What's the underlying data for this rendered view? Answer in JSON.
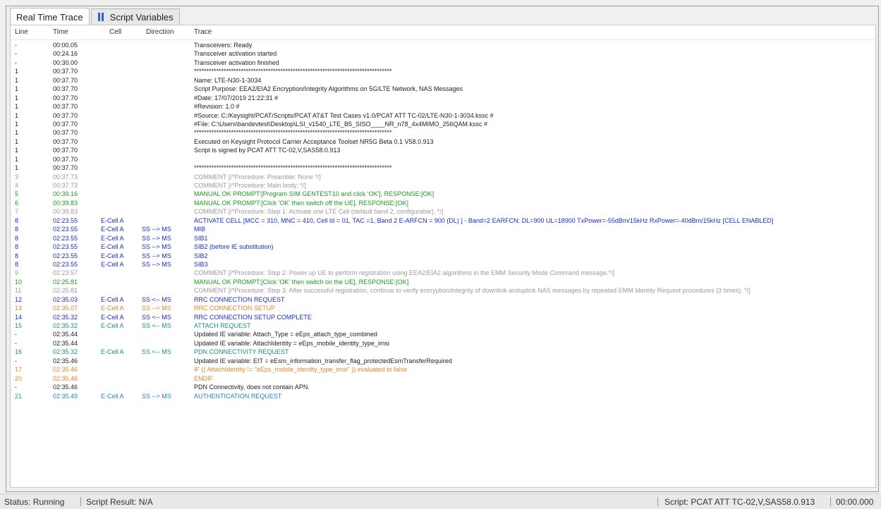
{
  "tabs": [
    {
      "label": "Real Time Trace"
    },
    {
      "label": "Script Variables"
    }
  ],
  "columns": {
    "line": "Line",
    "time": "Time",
    "cell": "Cell",
    "direction": "Direction",
    "trace": "Trace"
  },
  "rows": [
    {
      "line": "-",
      "time": "00:00.05",
      "cell": "",
      "dir": "",
      "trace": "Transceivers: Ready",
      "kind": "info"
    },
    {
      "line": "-",
      "time": "00:24.16",
      "cell": "",
      "dir": "",
      "trace": "Transceiver activation started",
      "kind": "info"
    },
    {
      "line": "-",
      "time": "00:30.00",
      "cell": "",
      "dir": "",
      "trace": "Transceiver activation finished",
      "kind": "info"
    },
    {
      "line": "1",
      "time": "00:37.70",
      "cell": "",
      "dir": "",
      "trace": "********************************************************************************",
      "kind": "info"
    },
    {
      "line": "1",
      "time": "00:37.70",
      "cell": "",
      "dir": "",
      "trace": "Name: LTE-N30-1-3034",
      "kind": "info"
    },
    {
      "line": "1",
      "time": "00:37.70",
      "cell": "",
      "dir": "",
      "trace": "Script Purpose: EEA2/EIA2 Encryption/Integrity Algorithms on 5G/LTE Network, NAS Messages",
      "kind": "info"
    },
    {
      "line": "1",
      "time": "00:37.70",
      "cell": "",
      "dir": "",
      "trace": "#Date: 17/07/2019 21:22:31 #",
      "kind": "info"
    },
    {
      "line": "1",
      "time": "00:37.70",
      "cell": "",
      "dir": "",
      "trace": "#Revision: 1.0 #",
      "kind": "info"
    },
    {
      "line": "1",
      "time": "00:37.70",
      "cell": "",
      "dir": "",
      "trace": "#Source: C:/Keysight/PCAT/Scripts/PCAT AT&T Test Cases v1.0/PCAT ATT TC-02/LTE-N30-1-3034.kssc #",
      "kind": "info"
    },
    {
      "line": "1",
      "time": "00:37.70",
      "cell": "",
      "dir": "",
      "trace": "#File: C:\\Users\\bandevtest\\Desktop\\LSI_v1540_LTE_B5_SISO____NR_n78_4x4MIMO_256QAM.kssc #",
      "kind": "info"
    },
    {
      "line": "1",
      "time": "00:37.70",
      "cell": "",
      "dir": "",
      "trace": "********************************************************************************",
      "kind": "info"
    },
    {
      "line": "1",
      "time": "00:37.70",
      "cell": "",
      "dir": "",
      "trace": "Executed on Keysight Protocol Carrier Acceptance Toolset NR5G Beta 0.1 V58.0.913",
      "kind": "info"
    },
    {
      "line": "1",
      "time": "00:37.70",
      "cell": "",
      "dir": "",
      "trace": "Script is signed by PCAT ATT TC-02,V,SAS58.0.913",
      "kind": "info"
    },
    {
      "line": "1",
      "time": "00:37.70",
      "cell": "",
      "dir": "",
      "trace": "",
      "kind": "info"
    },
    {
      "line": "1",
      "time": "00:37.70",
      "cell": "",
      "dir": "",
      "trace": "********************************************************************************",
      "kind": "info"
    },
    {
      "line": "3",
      "time": "00:37.73",
      "cell": "",
      "dir": "",
      "trace": "COMMENT [/*Procedure: Preamble: None */]",
      "kind": "comment"
    },
    {
      "line": "4",
      "time": "00:37.73",
      "cell": "",
      "dir": "",
      "trace": "COMMENT [/*Procedure: Main body: */]",
      "kind": "comment"
    },
    {
      "line": "5",
      "time": "00:39.16",
      "cell": "",
      "dir": "",
      "trace": "MANUAL OK PROMPT:[Program SIM GENTEST10 and click 'OK'], RESPONSE:[OK]",
      "kind": "manual"
    },
    {
      "line": "6",
      "time": "00:39.83",
      "cell": "",
      "dir": "",
      "trace": "MANUAL OK PROMPT:[Click 'OK' then switch off the UE], RESPONSE:[OK]",
      "kind": "manual"
    },
    {
      "line": "7",
      "time": "00:39.83",
      "cell": "",
      "dir": "",
      "trace": "COMMENT [/*Procedure: Step 1: Activate one LTE Cell (default band 2, configurable). */]",
      "kind": "comment"
    },
    {
      "line": "8",
      "time": "02:23.55",
      "cell": "E-Cell A",
      "dir": "",
      "trace": "ACTIVATE CELL [MCC = 310, MNC = 410, Cell Id = 01, TAC =1, Band 2 E-ARFCN = 900 (DL) ] - Band=2  EARFCN: DL=900 UL=18900  TxPower=-55dBm/15kHz  RxPower=-40dBm/15kHz  [CELL ENABLED]",
      "kind": "blue"
    },
    {
      "line": "8",
      "time": "02:23.55",
      "cell": "E-Cell A",
      "dir": "SS --> MS",
      "trace": "MIB",
      "kind": "blue"
    },
    {
      "line": "8",
      "time": "02:23.55",
      "cell": "E-Cell A",
      "dir": "SS --> MS",
      "trace": "SIB1",
      "kind": "blue"
    },
    {
      "line": "8",
      "time": "02:23.55",
      "cell": "E-Cell A",
      "dir": "SS --> MS",
      "trace": "SIB2 (before IE substitution)",
      "kind": "blue"
    },
    {
      "line": "8",
      "time": "02:23.55",
      "cell": "E-Cell A",
      "dir": "SS --> MS",
      "trace": "SIB2",
      "kind": "blue"
    },
    {
      "line": "8",
      "time": "02:23.55",
      "cell": "E-Cell A",
      "dir": "SS --> MS",
      "trace": "SIB3",
      "kind": "blue"
    },
    {
      "line": "9",
      "time": "02:23.57",
      "cell": "",
      "dir": "",
      "trace": "COMMENT [/*Procedure: Step 2: Power up UE to perform registration using EEA2/EIA2 algorithms in the EMM Security Mode Command message.*/]",
      "kind": "comment"
    },
    {
      "line": "10",
      "time": "02:25.81",
      "cell": "",
      "dir": "",
      "trace": "MANUAL OK PROMPT:[Click 'OK' then switch on the UE], RESPONSE:[OK]",
      "kind": "manual"
    },
    {
      "line": "11",
      "time": "02:25.81",
      "cell": "",
      "dir": "",
      "trace": "COMMENT [/*Procedure: Step 3: After successful registration, continue to verify encryption/integrity of downlink anduplink NAS messages by repeated EMM Identity Request procedures (3 times). */]",
      "kind": "comment"
    },
    {
      "line": "12",
      "time": "02:35.03",
      "cell": "E-Cell A",
      "dir": "SS <-- MS",
      "trace": "RRC CONNECTION REQUEST",
      "kind": "blue"
    },
    {
      "line": "13",
      "time": "02:35.07",
      "cell": "E-Cell A",
      "dir": "SS --> MS",
      "trace": "RRC CONNECTION SETUP",
      "kind": "orange"
    },
    {
      "line": "14",
      "time": "02:35.32",
      "cell": "E-Cell A",
      "dir": "SS <-- MS",
      "trace": "RRC CONNECTION SETUP COMPLETE",
      "kind": "blue"
    },
    {
      "line": "15",
      "time": "02:35.32",
      "cell": "E-Cell A",
      "dir": "SS <-- MS",
      "trace": "ATTACH REQUEST",
      "kind": "teal"
    },
    {
      "line": "-",
      "time": "02:35.44",
      "cell": "",
      "dir": "",
      "trace": "Updated IE variable: Attach_Type = eEps_attach_type_combined",
      "kind": "info"
    },
    {
      "line": "-",
      "time": "02:35.44",
      "cell": "",
      "dir": "",
      "trace": "Updated IE variable: AttachIdentity = eEps_mobile_identity_type_imsi",
      "kind": "info"
    },
    {
      "line": "16",
      "time": "02:35.32",
      "cell": "E-Cell A",
      "dir": "SS <-- MS",
      "trace": "PDN CONNECTIVITY REQUEST",
      "kind": "teal"
    },
    {
      "line": "-",
      "time": "02:35.46",
      "cell": "",
      "dir": "",
      "trace": "Updated IE variable: EIT = eEsm_information_transfer_flag_protectedEsmTransferRequired",
      "kind": "info"
    },
    {
      "line": "17",
      "time": "02:35.46",
      "cell": "",
      "dir": "",
      "trace": "IF (( AttachIdentity != \"eEps_mobile_identity_type_imsi\" )) evaluated to false",
      "kind": "orange"
    },
    {
      "line": "20",
      "time": "02:35.46",
      "cell": "",
      "dir": "",
      "trace": "ENDIF",
      "kind": "orange"
    },
    {
      "line": "-",
      "time": "02:35.46",
      "cell": "",
      "dir": "",
      "trace": "PDN Connectivity, does not contain APN.",
      "kind": "info"
    },
    {
      "line": "21",
      "time": "02:35.49",
      "cell": "E-Cell A",
      "dir": "SS --> MS",
      "trace": "AUTHENTICATION REQUEST",
      "kind": "cyan"
    }
  ],
  "status": {
    "state": "Status: Running",
    "result": "Script Result: N/A",
    "script": "Script: PCAT ATT TC-02,V,SAS58.0.913",
    "time": "00:00.000"
  }
}
